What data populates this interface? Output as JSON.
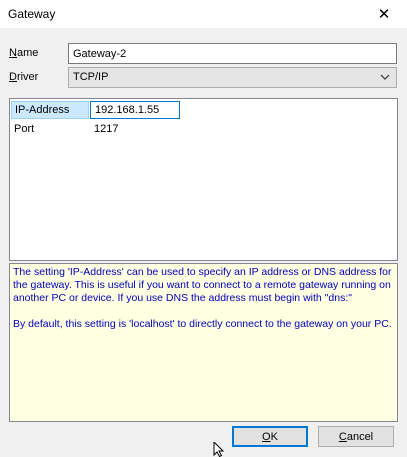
{
  "window": {
    "title": "Gateway",
    "close_glyph": "✕"
  },
  "form": {
    "name_label_mnemonic": "N",
    "name_label_rest": "ame",
    "name_value": "Gateway-2",
    "driver_label_mnemonic": "D",
    "driver_label_rest": "river",
    "driver_value": "TCP/IP"
  },
  "properties": [
    {
      "key": "IP-Address",
      "value": "192.168.1.55",
      "selected": true
    },
    {
      "key": "Port",
      "value": "1217",
      "selected": false
    }
  ],
  "help": {
    "paragraph1": "The setting 'IP-Address' can be used to specify an IP address or DNS address for the gateway. This is useful if you want to connect to a remote gateway running on another PC or device. If you use DNS the address must begin with \"dns:\"",
    "paragraph2": "By default, this setting is 'localhost' to directly connect to the gateway on your PC."
  },
  "buttons": {
    "ok_mnemonic": "O",
    "ok_rest": "K",
    "cancel_mnemonic": "C",
    "cancel_rest": "ancel"
  },
  "icons": {
    "close": "close-icon",
    "dropdown": "chevron-down-icon",
    "cursor": "mouse-pointer-icon"
  }
}
